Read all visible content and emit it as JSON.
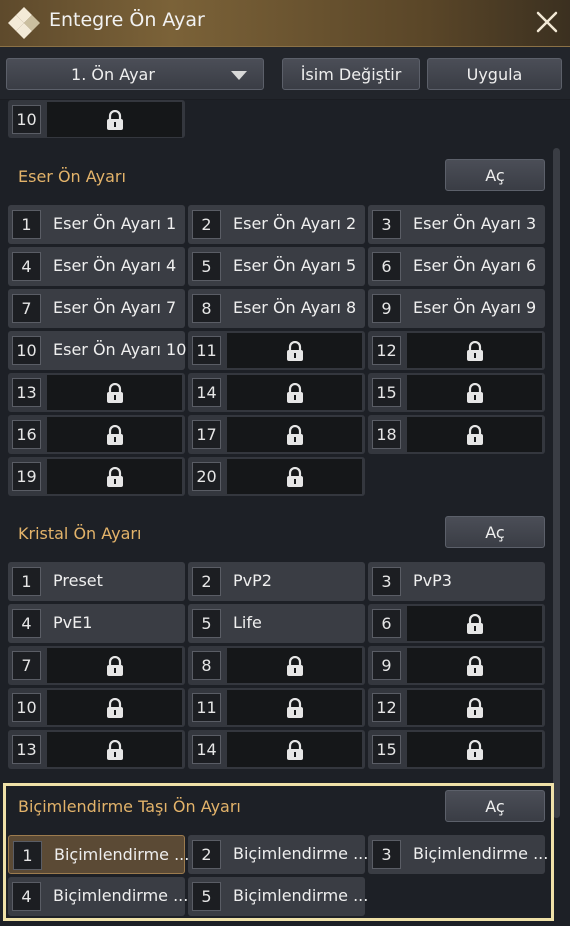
{
  "window": {
    "title": "Entegre Ön Ayar"
  },
  "toolbar": {
    "dropdown_value": "1. Ön Ayar",
    "rename_label": "İsim Değiştir",
    "apply_label": "Uygula"
  },
  "top_partial": {
    "num": "10"
  },
  "artifact": {
    "title": "Eser Ön Ayarı",
    "open_label": "Aç",
    "slots": [
      {
        "num": "1",
        "name": "Eser Ön Ayarı 1"
      },
      {
        "num": "2",
        "name": "Eser Ön Ayarı 2"
      },
      {
        "num": "3",
        "name": "Eser Ön Ayarı 3"
      },
      {
        "num": "4",
        "name": "Eser Ön Ayarı 4"
      },
      {
        "num": "5",
        "name": "Eser Ön Ayarı 5"
      },
      {
        "num": "6",
        "name": "Eser Ön Ayarı 6"
      },
      {
        "num": "7",
        "name": "Eser Ön Ayarı 7"
      },
      {
        "num": "8",
        "name": "Eser Ön Ayarı 8"
      },
      {
        "num": "9",
        "name": "Eser Ön Ayarı 9"
      },
      {
        "num": "10",
        "name": "Eser Ön Ayarı 10"
      },
      {
        "num": "11"
      },
      {
        "num": "12"
      },
      {
        "num": "13"
      },
      {
        "num": "14"
      },
      {
        "num": "15"
      },
      {
        "num": "16"
      },
      {
        "num": "17"
      },
      {
        "num": "18"
      },
      {
        "num": "19"
      },
      {
        "num": "20"
      }
    ]
  },
  "crystal": {
    "title": "Kristal Ön Ayarı",
    "open_label": "Aç",
    "slots": [
      {
        "num": "1",
        "name": "Preset"
      },
      {
        "num": "2",
        "name": "PvP2"
      },
      {
        "num": "3",
        "name": "PvP3"
      },
      {
        "num": "4",
        "name": "PvE1"
      },
      {
        "num": "5",
        "name": "Life"
      },
      {
        "num": "6"
      },
      {
        "num": "7"
      },
      {
        "num": "8"
      },
      {
        "num": "9"
      },
      {
        "num": "10"
      },
      {
        "num": "11"
      },
      {
        "num": "12"
      },
      {
        "num": "13"
      },
      {
        "num": "14"
      },
      {
        "num": "15"
      }
    ]
  },
  "formatting": {
    "title": "Biçimlendirme Taşı Ön Ayarı",
    "open_label": "Aç",
    "slots": [
      {
        "num": "1",
        "name": "Biçimlendirme ...",
        "selected": true
      },
      {
        "num": "2",
        "name": "Biçimlendirme ..."
      },
      {
        "num": "3",
        "name": "Biçimlendirme ..."
      },
      {
        "num": "4",
        "name": "Biçimlendirme ..."
      },
      {
        "num": "5",
        "name": "Biçimlendirme ..."
      }
    ]
  }
}
